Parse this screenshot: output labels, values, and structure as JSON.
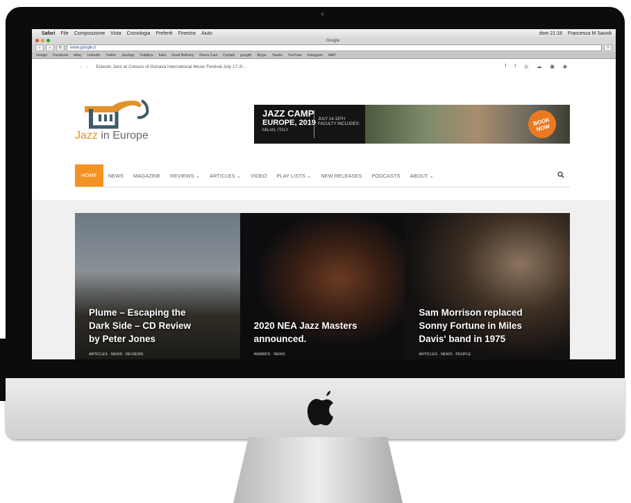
{
  "browser": {
    "menubar": {
      "app": "Safari",
      "items": [
        "File",
        "Composizione",
        "Vista",
        "Cronologia",
        "Preferiti",
        "Finestra",
        "Aiuto"
      ],
      "status": [
        "dom 21:18",
        "Francesca M Savioli"
      ]
    },
    "window_title": "Google",
    "url": "www.google.it",
    "bookmarks": [
      "Google",
      "Facebook",
      "eBay",
      "LinkedIn",
      "Twitter",
      "Jazzbay",
      "Pubblica",
      "Italia",
      "Good Bethany",
      "Rivers Cast",
      "Contatti",
      "jazzgift",
      "Skype",
      "Yaudio",
      "YouTube",
      "Instagram",
      "MAP"
    ]
  },
  "site": {
    "ticker": "Eclectic Jazz at Colours of Ostrava International Music Festival July 17-2l...",
    "social_icons": [
      "facebook-icon",
      "twitter-icon",
      "instagram-icon",
      "soundcloud-icon",
      "mixcloud-icon",
      "rss-icon"
    ],
    "logo": {
      "word1": "Jazz",
      "word2": " in Europe"
    },
    "banner": {
      "title": "JAZZ CAMP",
      "subtitle": "EUROPE, 2019",
      "place": "MILAN, ITALY",
      "dates": "JULY 14-19TH",
      "faculty": "FACULTY INCLUDES:",
      "cta": "BOOK NOW"
    },
    "nav": {
      "home": "HOME",
      "items": [
        "NEWS",
        "MAGAZINE",
        "REVIEWS ⌄",
        "ARTICLES ⌄",
        "VIDEO",
        "PLAY LISTS ⌄",
        "NEW RELEASES",
        "PODCASTS",
        "ABOUT ⌄"
      ]
    },
    "cards": [
      {
        "title": "Plume – Escaping the Dark Side – CD Review by Peter Jones",
        "tags": "ARTICLES · NEWS · REVIEWS"
      },
      {
        "title": "2020 NEA Jazz Masters announced.",
        "tags": "AWARDS · NEWS"
      },
      {
        "title": "Sam Morrison replaced Sonny Fortune in Miles Davis' band in 1975",
        "tags": "ARTICLES · NEWS · PEOPLE"
      }
    ]
  },
  "colors": {
    "accent": "#f39322",
    "logo_orange": "#e2922a"
  }
}
